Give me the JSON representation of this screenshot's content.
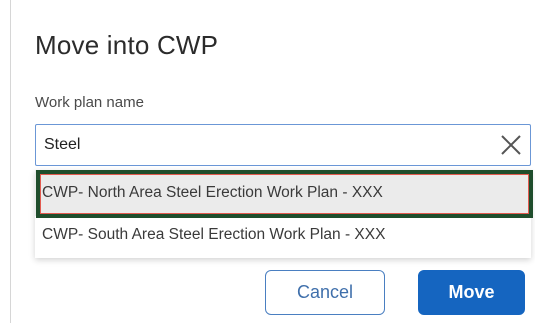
{
  "dialog": {
    "title": "Move into CWP",
    "field_label": "Work plan name",
    "search_value": "Steel",
    "options": [
      {
        "label": "CWP- North Area Steel Erection Work Plan - XXX",
        "highlighted": true
      },
      {
        "label": "CWP- South Area Steel Erection Work Plan - XXX",
        "highlighted": false
      }
    ],
    "buttons": {
      "cancel_label": "Cancel",
      "move_label": "Move"
    },
    "icons": {
      "clear": "close-icon"
    }
  },
  "colors": {
    "primary": "#1565c0",
    "highlight_border": "#1f4d2c",
    "selection_outline": "#e25a4f",
    "input_focus_border": "#6b97d6"
  }
}
